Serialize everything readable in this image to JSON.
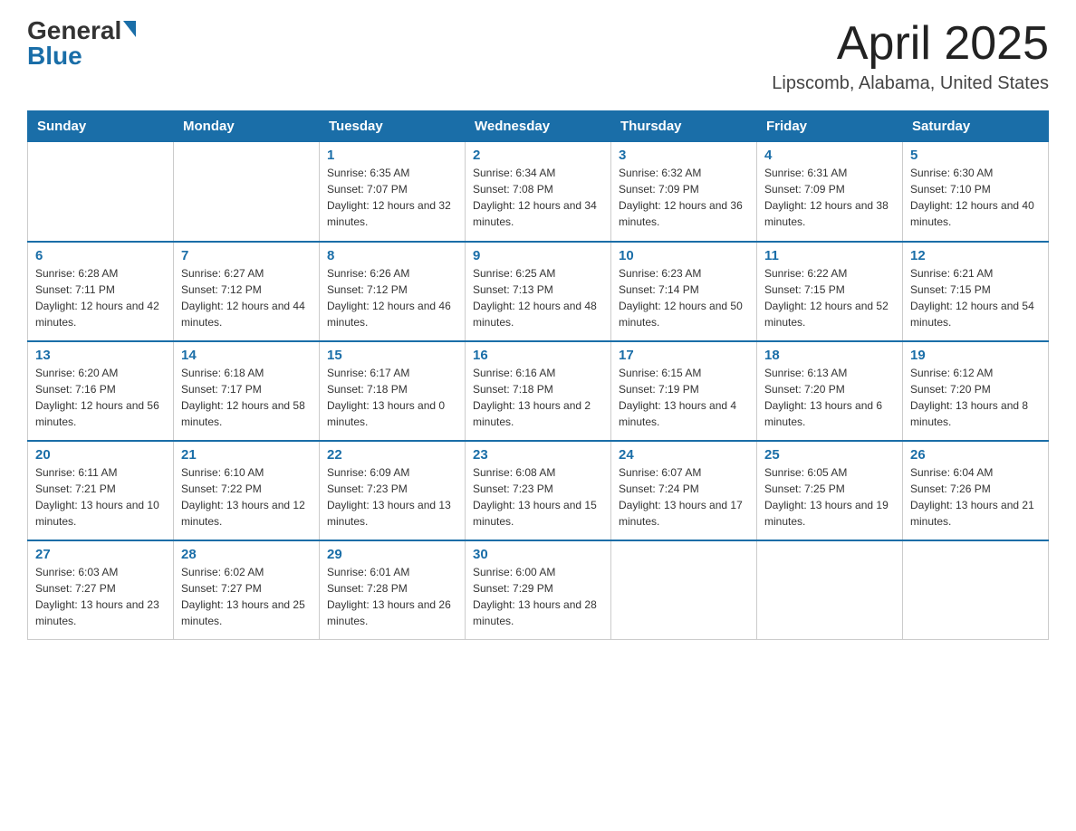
{
  "header": {
    "logo_general": "General",
    "logo_blue": "Blue",
    "month_title": "April 2025",
    "subtitle": "Lipscomb, Alabama, United States"
  },
  "days_of_week": [
    "Sunday",
    "Monday",
    "Tuesday",
    "Wednesday",
    "Thursday",
    "Friday",
    "Saturday"
  ],
  "weeks": [
    [
      {
        "day": "",
        "sunrise": "",
        "sunset": "",
        "daylight": ""
      },
      {
        "day": "",
        "sunrise": "",
        "sunset": "",
        "daylight": ""
      },
      {
        "day": "1",
        "sunrise": "Sunrise: 6:35 AM",
        "sunset": "Sunset: 7:07 PM",
        "daylight": "Daylight: 12 hours and 32 minutes."
      },
      {
        "day": "2",
        "sunrise": "Sunrise: 6:34 AM",
        "sunset": "Sunset: 7:08 PM",
        "daylight": "Daylight: 12 hours and 34 minutes."
      },
      {
        "day": "3",
        "sunrise": "Sunrise: 6:32 AM",
        "sunset": "Sunset: 7:09 PM",
        "daylight": "Daylight: 12 hours and 36 minutes."
      },
      {
        "day": "4",
        "sunrise": "Sunrise: 6:31 AM",
        "sunset": "Sunset: 7:09 PM",
        "daylight": "Daylight: 12 hours and 38 minutes."
      },
      {
        "day": "5",
        "sunrise": "Sunrise: 6:30 AM",
        "sunset": "Sunset: 7:10 PM",
        "daylight": "Daylight: 12 hours and 40 minutes."
      }
    ],
    [
      {
        "day": "6",
        "sunrise": "Sunrise: 6:28 AM",
        "sunset": "Sunset: 7:11 PM",
        "daylight": "Daylight: 12 hours and 42 minutes."
      },
      {
        "day": "7",
        "sunrise": "Sunrise: 6:27 AM",
        "sunset": "Sunset: 7:12 PM",
        "daylight": "Daylight: 12 hours and 44 minutes."
      },
      {
        "day": "8",
        "sunrise": "Sunrise: 6:26 AM",
        "sunset": "Sunset: 7:12 PM",
        "daylight": "Daylight: 12 hours and 46 minutes."
      },
      {
        "day": "9",
        "sunrise": "Sunrise: 6:25 AM",
        "sunset": "Sunset: 7:13 PM",
        "daylight": "Daylight: 12 hours and 48 minutes."
      },
      {
        "day": "10",
        "sunrise": "Sunrise: 6:23 AM",
        "sunset": "Sunset: 7:14 PM",
        "daylight": "Daylight: 12 hours and 50 minutes."
      },
      {
        "day": "11",
        "sunrise": "Sunrise: 6:22 AM",
        "sunset": "Sunset: 7:15 PM",
        "daylight": "Daylight: 12 hours and 52 minutes."
      },
      {
        "day": "12",
        "sunrise": "Sunrise: 6:21 AM",
        "sunset": "Sunset: 7:15 PM",
        "daylight": "Daylight: 12 hours and 54 minutes."
      }
    ],
    [
      {
        "day": "13",
        "sunrise": "Sunrise: 6:20 AM",
        "sunset": "Sunset: 7:16 PM",
        "daylight": "Daylight: 12 hours and 56 minutes."
      },
      {
        "day": "14",
        "sunrise": "Sunrise: 6:18 AM",
        "sunset": "Sunset: 7:17 PM",
        "daylight": "Daylight: 12 hours and 58 minutes."
      },
      {
        "day": "15",
        "sunrise": "Sunrise: 6:17 AM",
        "sunset": "Sunset: 7:18 PM",
        "daylight": "Daylight: 13 hours and 0 minutes."
      },
      {
        "day": "16",
        "sunrise": "Sunrise: 6:16 AM",
        "sunset": "Sunset: 7:18 PM",
        "daylight": "Daylight: 13 hours and 2 minutes."
      },
      {
        "day": "17",
        "sunrise": "Sunrise: 6:15 AM",
        "sunset": "Sunset: 7:19 PM",
        "daylight": "Daylight: 13 hours and 4 minutes."
      },
      {
        "day": "18",
        "sunrise": "Sunrise: 6:13 AM",
        "sunset": "Sunset: 7:20 PM",
        "daylight": "Daylight: 13 hours and 6 minutes."
      },
      {
        "day": "19",
        "sunrise": "Sunrise: 6:12 AM",
        "sunset": "Sunset: 7:20 PM",
        "daylight": "Daylight: 13 hours and 8 minutes."
      }
    ],
    [
      {
        "day": "20",
        "sunrise": "Sunrise: 6:11 AM",
        "sunset": "Sunset: 7:21 PM",
        "daylight": "Daylight: 13 hours and 10 minutes."
      },
      {
        "day": "21",
        "sunrise": "Sunrise: 6:10 AM",
        "sunset": "Sunset: 7:22 PM",
        "daylight": "Daylight: 13 hours and 12 minutes."
      },
      {
        "day": "22",
        "sunrise": "Sunrise: 6:09 AM",
        "sunset": "Sunset: 7:23 PM",
        "daylight": "Daylight: 13 hours and 13 minutes."
      },
      {
        "day": "23",
        "sunrise": "Sunrise: 6:08 AM",
        "sunset": "Sunset: 7:23 PM",
        "daylight": "Daylight: 13 hours and 15 minutes."
      },
      {
        "day": "24",
        "sunrise": "Sunrise: 6:07 AM",
        "sunset": "Sunset: 7:24 PM",
        "daylight": "Daylight: 13 hours and 17 minutes."
      },
      {
        "day": "25",
        "sunrise": "Sunrise: 6:05 AM",
        "sunset": "Sunset: 7:25 PM",
        "daylight": "Daylight: 13 hours and 19 minutes."
      },
      {
        "day": "26",
        "sunrise": "Sunrise: 6:04 AM",
        "sunset": "Sunset: 7:26 PM",
        "daylight": "Daylight: 13 hours and 21 minutes."
      }
    ],
    [
      {
        "day": "27",
        "sunrise": "Sunrise: 6:03 AM",
        "sunset": "Sunset: 7:27 PM",
        "daylight": "Daylight: 13 hours and 23 minutes."
      },
      {
        "day": "28",
        "sunrise": "Sunrise: 6:02 AM",
        "sunset": "Sunset: 7:27 PM",
        "daylight": "Daylight: 13 hours and 25 minutes."
      },
      {
        "day": "29",
        "sunrise": "Sunrise: 6:01 AM",
        "sunset": "Sunset: 7:28 PM",
        "daylight": "Daylight: 13 hours and 26 minutes."
      },
      {
        "day": "30",
        "sunrise": "Sunrise: 6:00 AM",
        "sunset": "Sunset: 7:29 PM",
        "daylight": "Daylight: 13 hours and 28 minutes."
      },
      {
        "day": "",
        "sunrise": "",
        "sunset": "",
        "daylight": ""
      },
      {
        "day": "",
        "sunrise": "",
        "sunset": "",
        "daylight": ""
      },
      {
        "day": "",
        "sunrise": "",
        "sunset": "",
        "daylight": ""
      }
    ]
  ]
}
